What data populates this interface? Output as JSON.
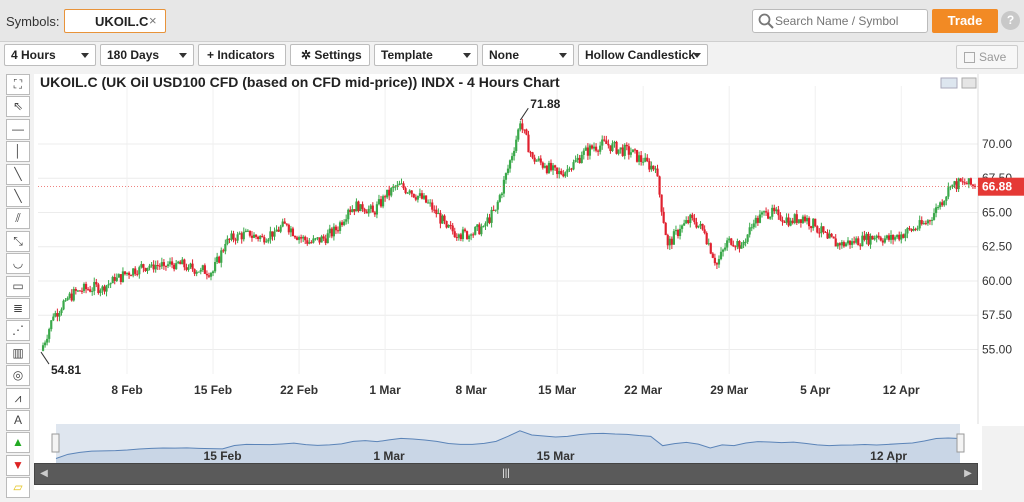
{
  "header": {
    "symbols_label": "Symbols:",
    "symbol_value": "UKOIL.C",
    "remove_symbol": "×",
    "search_placeholder": "Search Name / Symbol",
    "trade_label": "Trade",
    "help_label": "?"
  },
  "toolbar": {
    "interval": "4 Hours",
    "period": "180 Days",
    "indicators": "Indicators",
    "settings": "Settings",
    "template": "Template",
    "none": "None",
    "chart_type": "Hollow Candlestick",
    "save": "Save"
  },
  "sidebar": {
    "items": [
      "crosshair-tool",
      "pointer-tool",
      "horizontal-line-tool",
      "vertical-line-tool",
      "trend-line-tool",
      "ray-tool",
      "parallel-lines-tool",
      "extended-line-tool",
      "arc-tool",
      "rectangle-tool",
      "fibonacci-tool",
      "fan-tool",
      "gann-tool",
      "spiral-tool",
      "wave-tool",
      "text-tool",
      "buy-arrow-tool",
      "sell-arrow-tool",
      "eraser-tool"
    ],
    "text_tool_label": "A"
  },
  "chart": {
    "title": "UKOIL.C (UK Oil USD100 CFD (based on CFD mid-price)) INDX - 4 Hours Chart",
    "high_label": "71.88",
    "low_label": "54.81",
    "last_price": "66.88",
    "last_price_color": "#e53935",
    "up_color": "#3aa84a",
    "down_color": "#e0202e"
  },
  "chart_data": {
    "type": "candlestick",
    "title": "UKOIL.C (UK Oil USD100 CFD (based on CFD mid-price)) INDX - 4 Hours Chart",
    "ylim": [
      53.5,
      73.5
    ],
    "y_ticks": [
      "55.00",
      "57.50",
      "60.00",
      "62.50",
      "65.00",
      "67.50",
      "70.00"
    ],
    "x_ticks": [
      "8 Feb",
      "15 Feb",
      "22 Feb",
      "1 Mar",
      "8 Mar",
      "15 Mar",
      "22 Mar",
      "29 Mar",
      "5 Apr",
      "12 Apr"
    ],
    "x_tick_days": [
      8,
      15,
      22,
      29,
      36,
      43,
      50,
      57,
      64,
      71
    ],
    "x_range_days": [
      1,
      77
    ],
    "series": [
      {
        "name": "UKOIL.C",
        "points": [
          [
            1,
            54.9
          ],
          [
            2,
            57.4
          ],
          [
            3,
            58.6
          ],
          [
            4,
            59.3
          ],
          [
            6,
            59.6
          ],
          [
            7,
            60.0
          ],
          [
            8,
            60.6
          ],
          [
            9,
            61.0
          ],
          [
            10,
            61.2
          ],
          [
            11,
            61.1
          ],
          [
            12,
            61.3
          ],
          [
            13,
            61.0
          ],
          [
            14,
            60.8
          ],
          [
            15,
            60.7
          ],
          [
            16,
            62.7
          ],
          [
            17,
            63.4
          ],
          [
            18,
            63.3
          ],
          [
            19,
            63.2
          ],
          [
            20,
            63.6
          ],
          [
            21,
            64.1
          ],
          [
            22,
            63.2
          ],
          [
            23,
            62.8
          ],
          [
            24,
            63.1
          ],
          [
            25,
            63.7
          ],
          [
            26,
            65.2
          ],
          [
            27,
            65.6
          ],
          [
            28,
            65.0
          ],
          [
            29,
            66.1
          ],
          [
            30,
            67.0
          ],
          [
            31,
            66.6
          ],
          [
            32,
            66.0
          ],
          [
            33,
            65.2
          ],
          [
            34,
            63.9
          ],
          [
            35,
            63.4
          ],
          [
            36,
            63.4
          ],
          [
            37,
            64.0
          ],
          [
            38,
            65.2
          ],
          [
            39,
            68.2
          ],
          [
            40,
            71.5
          ],
          [
            41,
            69.0
          ],
          [
            42,
            68.4
          ],
          [
            43,
            67.8
          ],
          [
            44,
            68.2
          ],
          [
            45,
            69.2
          ],
          [
            46,
            69.8
          ],
          [
            47,
            70.0
          ],
          [
            48,
            69.6
          ],
          [
            49,
            69.4
          ],
          [
            50,
            68.7
          ],
          [
            51,
            68.2
          ],
          [
            52,
            62.6
          ],
          [
            53,
            63.8
          ],
          [
            54,
            64.6
          ],
          [
            55,
            63.5
          ],
          [
            56,
            61.2
          ],
          [
            57,
            63.1
          ],
          [
            58,
            62.6
          ],
          [
            59,
            64.2
          ],
          [
            60,
            65.0
          ],
          [
            61,
            64.8
          ],
          [
            62,
            64.4
          ],
          [
            63,
            64.7
          ],
          [
            64,
            64.0
          ],
          [
            65,
            63.1
          ],
          [
            66,
            62.6
          ],
          [
            67,
            62.9
          ],
          [
            68,
            63.0
          ],
          [
            69,
            63.3
          ],
          [
            70,
            63.0
          ],
          [
            71,
            63.4
          ],
          [
            72,
            63.8
          ],
          [
            73,
            64.2
          ],
          [
            74,
            65.4
          ],
          [
            75,
            66.9
          ],
          [
            76,
            67.2
          ],
          [
            77,
            66.9
          ]
        ]
      }
    ],
    "high_annotation": {
      "day": 40,
      "value": 71.88
    },
    "low_annotation": {
      "day": 1,
      "value": 54.81
    },
    "navigator": {
      "x_ticks": [
        "15 Feb",
        "1 Mar",
        "15 Mar",
        "12 Apr"
      ],
      "x_tick_days": [
        15,
        29,
        43,
        71
      ]
    }
  }
}
